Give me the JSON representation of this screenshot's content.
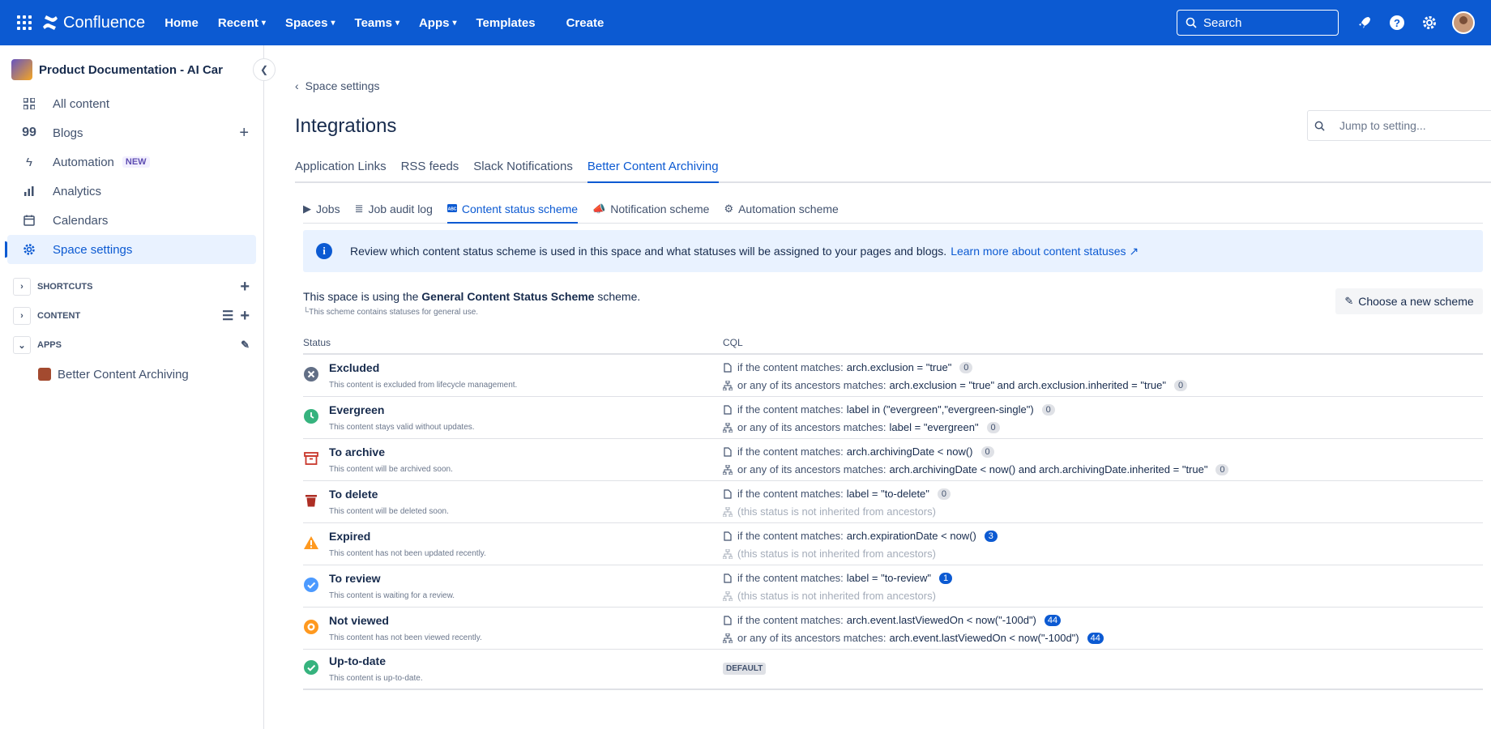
{
  "header": {
    "product": "Confluence",
    "nav": [
      {
        "label": "Home",
        "dropdown": false
      },
      {
        "label": "Recent",
        "dropdown": true
      },
      {
        "label": "Spaces",
        "dropdown": true
      },
      {
        "label": "Teams",
        "dropdown": true
      },
      {
        "label": "Apps",
        "dropdown": true
      },
      {
        "label": "Templates",
        "dropdown": false
      }
    ],
    "create_label": "Create",
    "search_placeholder": "Search",
    "brand_color": "#0c5ad2"
  },
  "sidebar": {
    "space_name": "Product Documentation - AI Car",
    "items": [
      {
        "label": "All content",
        "icon": "grid-icon"
      },
      {
        "label": "Blogs",
        "icon": "quote-icon"
      },
      {
        "label": "Automation",
        "icon": "lightning-icon",
        "badge": "NEW"
      },
      {
        "label": "Analytics",
        "icon": "bar-chart-icon"
      },
      {
        "label": "Calendars",
        "icon": "calendar-icon"
      },
      {
        "label": "Space settings",
        "icon": "gear-icon"
      }
    ],
    "sections": [
      {
        "label": "SHORTCUTS"
      },
      {
        "label": "CONTENT"
      },
      {
        "label": "APPS"
      }
    ],
    "apps": [
      {
        "label": "Better Content Archiving"
      }
    ]
  },
  "main": {
    "back_label": "Space settings",
    "title": "Integrations",
    "jump_placeholder": "Jump to setting...",
    "tabs": [
      "Application Links",
      "RSS feeds",
      "Slack Notifications",
      "Better Content Archiving"
    ],
    "subtabs": [
      {
        "label": "Jobs",
        "icon": "play-icon"
      },
      {
        "label": "Job audit log",
        "icon": "list-icon"
      },
      {
        "label": "Content status scheme",
        "icon": "abc-icon"
      },
      {
        "label": "Notification scheme",
        "icon": "megaphone-icon"
      },
      {
        "label": "Automation scheme",
        "icon": "cogs-icon"
      }
    ],
    "info_text": "Review which content status scheme is used in this space and what statuses will be assigned to your pages and blogs.",
    "info_link": "Learn more about content statuses ↗",
    "scheme_prefix": "This space is using the",
    "scheme_name": "General Content Status Scheme",
    "scheme_suffix": "scheme.",
    "scheme_desc": "└This scheme contains statuses for general use.",
    "choose_label": "Choose a new scheme",
    "table": {
      "col_status": "Status",
      "col_cql": "CQL",
      "rows": [
        {
          "name": "Excluded",
          "desc": "This content is excluded from lifecycle management.",
          "icon": "excluded-icon",
          "color": "#626f86",
          "l1_lead": "if the content matches:",
          "l1_query": "arch.exclusion = \"true\"",
          "l1_count": "0",
          "l2_lead": "or any of its ancestors matches:",
          "l2_query": "arch.exclusion = \"true\" and arch.exclusion.inherited = \"true\"",
          "l2_count": "0"
        },
        {
          "name": "Evergreen",
          "desc": "This content stays valid without updates.",
          "icon": "evergreen-clock-icon",
          "color": "#36b37e",
          "l1_lead": "if the content matches:",
          "l1_query": "label in (\"evergreen\",\"evergreen-single\")",
          "l1_count": "0",
          "l2_lead": "or any of its ancestors matches:",
          "l2_query": "label = \"evergreen\"",
          "l2_count": "0"
        },
        {
          "name": "To archive",
          "desc": "This content will be archived soon.",
          "icon": "archive-box-icon",
          "color": "#c9372c",
          "l1_lead": "if the content matches:",
          "l1_query": "arch.archivingDate < now()",
          "l1_count": "0",
          "l2_lead": "or any of its ancestors matches:",
          "l2_query": "arch.archivingDate < now() and arch.archivingDate.inherited = \"true\"",
          "l2_count": "0"
        },
        {
          "name": "To delete",
          "desc": "This content will be deleted soon.",
          "icon": "trash-icon",
          "color": "#ae2e24",
          "l1_lead": "if the content matches:",
          "l1_query": "label = \"to-delete\"",
          "l1_count": "0",
          "l2_muted": "(this status is not inherited from ancestors)"
        },
        {
          "name": "Expired",
          "desc": "This content has not been updated recently.",
          "icon": "warning-icon",
          "color": "#ff991f",
          "l1_lead": "if the content matches:",
          "l1_query": "arch.expirationDate < now()",
          "l1_count": "3",
          "l1_count_blue": true,
          "l2_muted": "(this status is not inherited from ancestors)"
        },
        {
          "name": "To review",
          "desc": "This content is waiting for a review.",
          "icon": "review-check-icon",
          "color": "#4c9aff",
          "l1_lead": "if the content matches:",
          "l1_query": "label = \"to-review\"",
          "l1_count": "1",
          "l1_count_blue": true,
          "l2_muted": "(this status is not inherited from ancestors)"
        },
        {
          "name": "Not viewed",
          "desc": "This content has not been viewed recently.",
          "icon": "eye-icon",
          "color": "#ff991f",
          "l1_lead": "if the content matches:",
          "l1_query": "arch.event.lastViewedOn < now(\"-100d\")",
          "l1_count": "44",
          "l1_count_blue": true,
          "l2_lead": "or any of its ancestors matches:",
          "l2_query": "arch.event.lastViewedOn < now(\"-100d\")",
          "l2_count": "44",
          "l2_count_blue": true
        },
        {
          "name": "Up-to-date",
          "desc": "This content is up-to-date.",
          "icon": "up-to-date-check-icon",
          "color": "#36b37e",
          "default_tag": "DEFAULT"
        }
      ]
    }
  }
}
